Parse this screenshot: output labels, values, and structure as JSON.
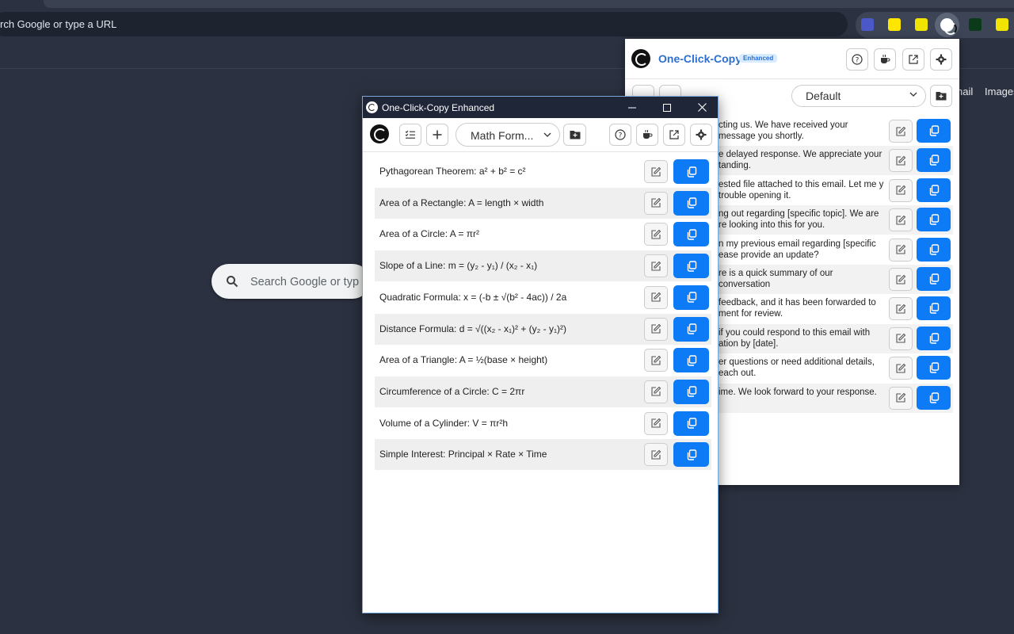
{
  "browser": {
    "omnibox_text": "rch Google or type a URL",
    "page_links": [
      "nail",
      "Images"
    ]
  },
  "google": {
    "search_placeholder": "Search Google or typ"
  },
  "popup": {
    "title": "One-Click-Copy",
    "badge": "Enhanced",
    "folder_select": "Default",
    "snippets": [
      "cting us. We have received your message you shortly.",
      "e delayed response. We appreciate your tanding.",
      "ested file attached to this email. Let me y trouble opening it.",
      "ng out regarding [specific topic]. We are re looking into this for you.",
      "n my previous email regarding [specific ease provide an update?",
      "re is a quick summary of our conversation",
      "feedback, and it has been forwarded to ment for review.",
      " if you could respond to this email with ation by [date].",
      "er questions or need additional details, each out.",
      "ime. We look forward to your response."
    ]
  },
  "window": {
    "title": "One-Click-Copy Enhanced",
    "folder_select": "Math Form...",
    "snippets": [
      "Pythagorean Theorem: a² + b² = c²",
      "Area of a Rectangle: A = length × width",
      "Area of a Circle: A = πr²",
      "Slope of a Line: m = (y₂ - y₁) / (x₂ - x₁)",
      "Quadratic Formula: x = (-b ± √(b² - 4ac)) / 2a",
      "Distance Formula: d = √((x₂ - x₁)² + (y₂ - y₁)²)",
      "Area of a Triangle: A = ½(base × height)",
      "Circumference of a Circle: C = 2πr",
      "Volume of a Cylinder: V = πr²h",
      "Simple Interest: Principal × Rate × Time"
    ]
  },
  "colors": {
    "accent": "#0c7bf5",
    "brand_title": "#2c6fd1",
    "titlebar": "#1f2637",
    "desktop": "#2b3140"
  }
}
